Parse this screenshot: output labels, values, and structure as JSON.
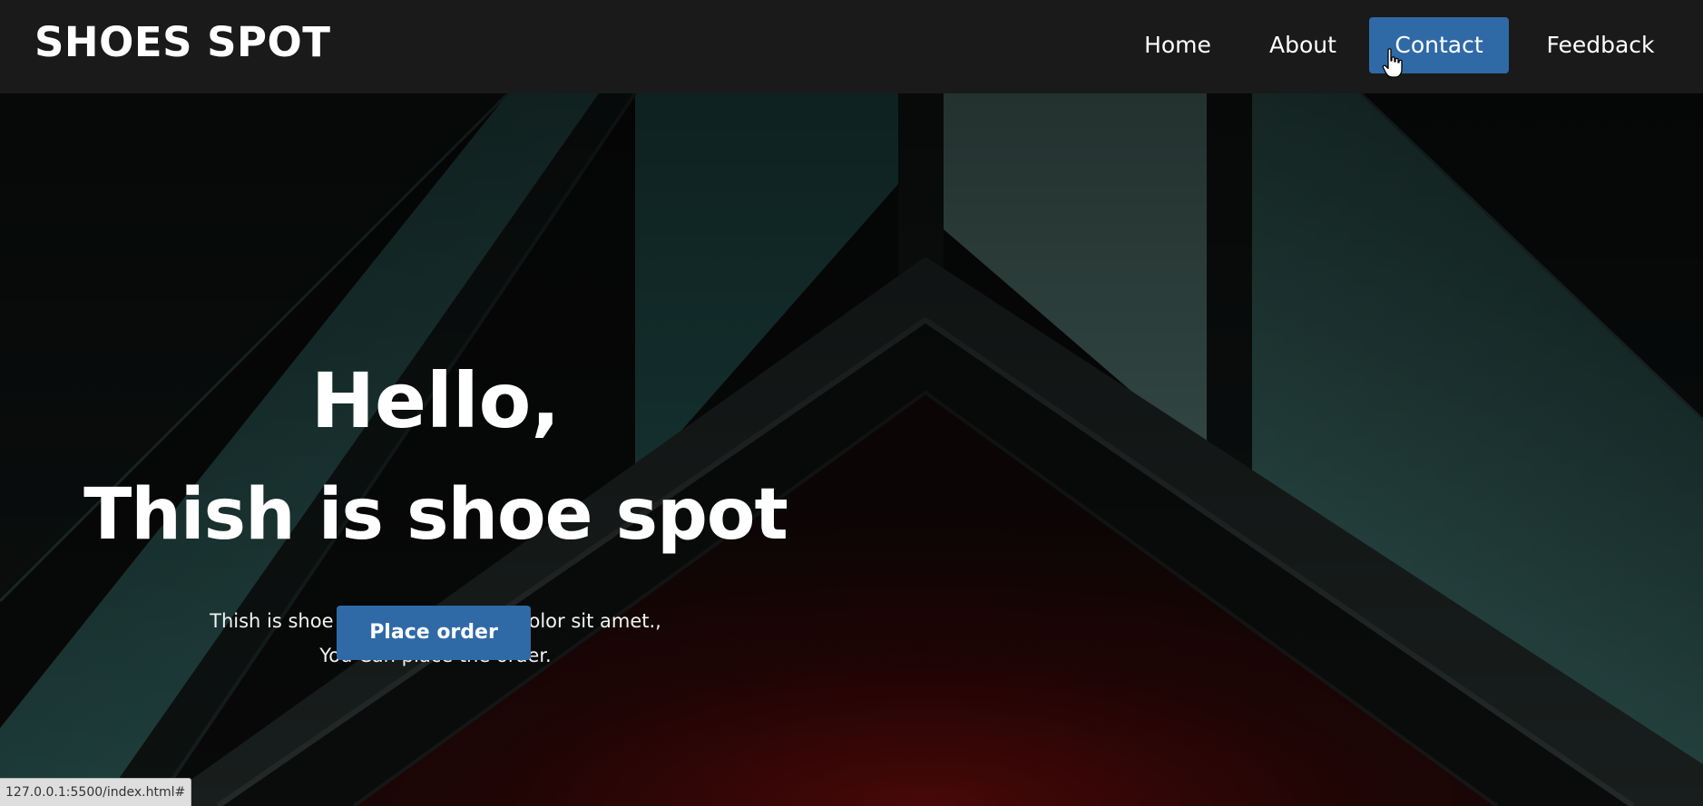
{
  "navbar": {
    "brand": "SHOES SPOT",
    "items": [
      {
        "label": "Home"
      },
      {
        "label": "About"
      },
      {
        "label": "Contact",
        "active": true
      },
      {
        "label": "Feedback"
      }
    ]
  },
  "hero": {
    "title_line1": "Hello,",
    "title_line2": "Thish is shoe spot",
    "text_line1": "Thish is shoe spot Lorem ipsum dolor sit amet.,",
    "text_line2": "You Can place the order.",
    "button_label": "Place order"
  },
  "status_bar": {
    "url": "127.0.0.1:5500/index.html#"
  },
  "colors": {
    "navbar_bg": "#1a1a1a",
    "accent": "#2f6aa6",
    "text": "#ffffff"
  },
  "icons": {
    "cursor": "hand-pointer-icon"
  }
}
